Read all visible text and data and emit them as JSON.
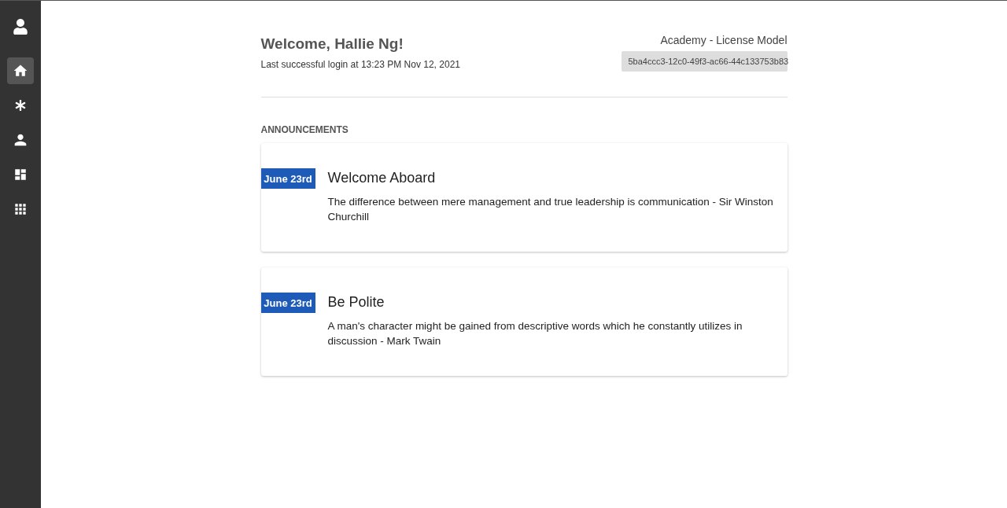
{
  "sidebar": {
    "items": [
      {
        "kind": "avatar",
        "selected": false
      },
      {
        "kind": "home",
        "selected": true
      },
      {
        "kind": "asterisk",
        "selected": false
      },
      {
        "kind": "person",
        "selected": false
      },
      {
        "kind": "dashboard",
        "selected": false
      },
      {
        "kind": "apps",
        "selected": false
      }
    ]
  },
  "header": {
    "greeting": "Welcome, Hallie Ng!",
    "last_login": "Last successful login at 13:23 PM Nov 12, 2021",
    "product": "Academy - License Model",
    "license_key": "5ba4ccc3-12c0-49f3-ac66-44c133753b83"
  },
  "announcements": {
    "title": "ANNOUNCEMENTS",
    "items": [
      {
        "date": "June 23rd",
        "title": "Welcome Aboard",
        "body": "The difference between mere management and true leadership is communication - Sir Winston Churchill"
      },
      {
        "date": "June 23rd",
        "title": "Be Polite",
        "body": "A man's character might be gained from descriptive words which he constantly utilizes in discussion - Mark Twain"
      }
    ]
  }
}
